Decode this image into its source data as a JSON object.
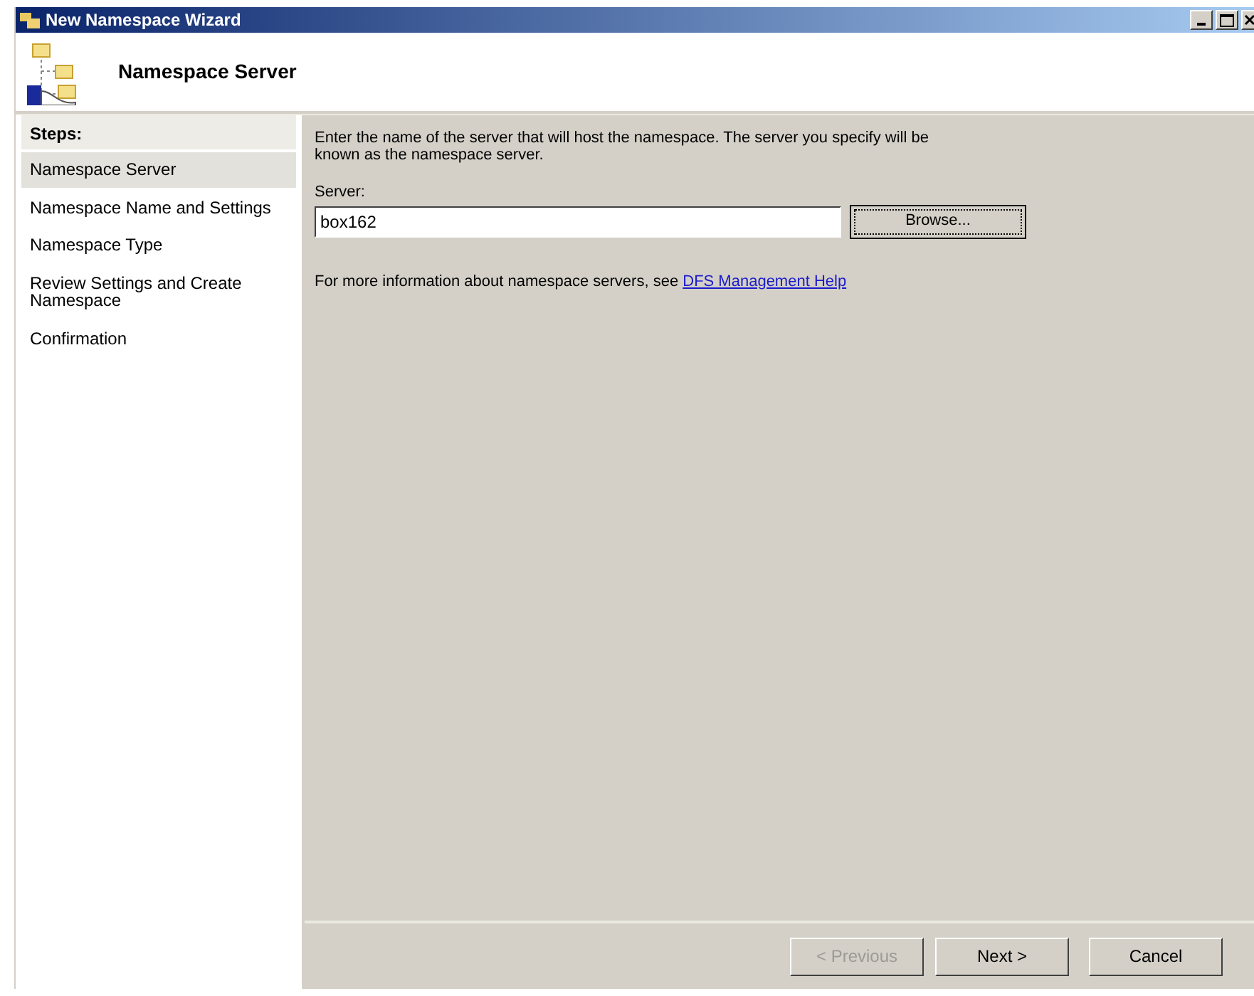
{
  "window": {
    "title": "New Namespace Wizard"
  },
  "header": {
    "title": "Namespace Server"
  },
  "steps": {
    "heading": "Steps:",
    "items": [
      {
        "label": "Namespace Server",
        "selected": true
      },
      {
        "label": "Namespace Name and Settings",
        "selected": false
      },
      {
        "label": "Namespace Type",
        "selected": false
      },
      {
        "label": "Review Settings and Create Namespace",
        "selected": false
      },
      {
        "label": "Confirmation",
        "selected": false
      }
    ]
  },
  "content": {
    "instructions": "Enter the name of the server that will host the namespace. The server you specify will be known as the namespace server.",
    "server_label": "Server:",
    "server_value": "box162",
    "browse_button": "Browse...",
    "help_text": "For more information about namespace servers, see",
    "help_link": "DFS Management Help"
  },
  "buttons": [
    {
      "label": "< Previous",
      "disabled": true
    },
    {
      "label": "Next >",
      "disabled": false
    },
    {
      "label": "Cancel",
      "disabled": false
    }
  ]
}
